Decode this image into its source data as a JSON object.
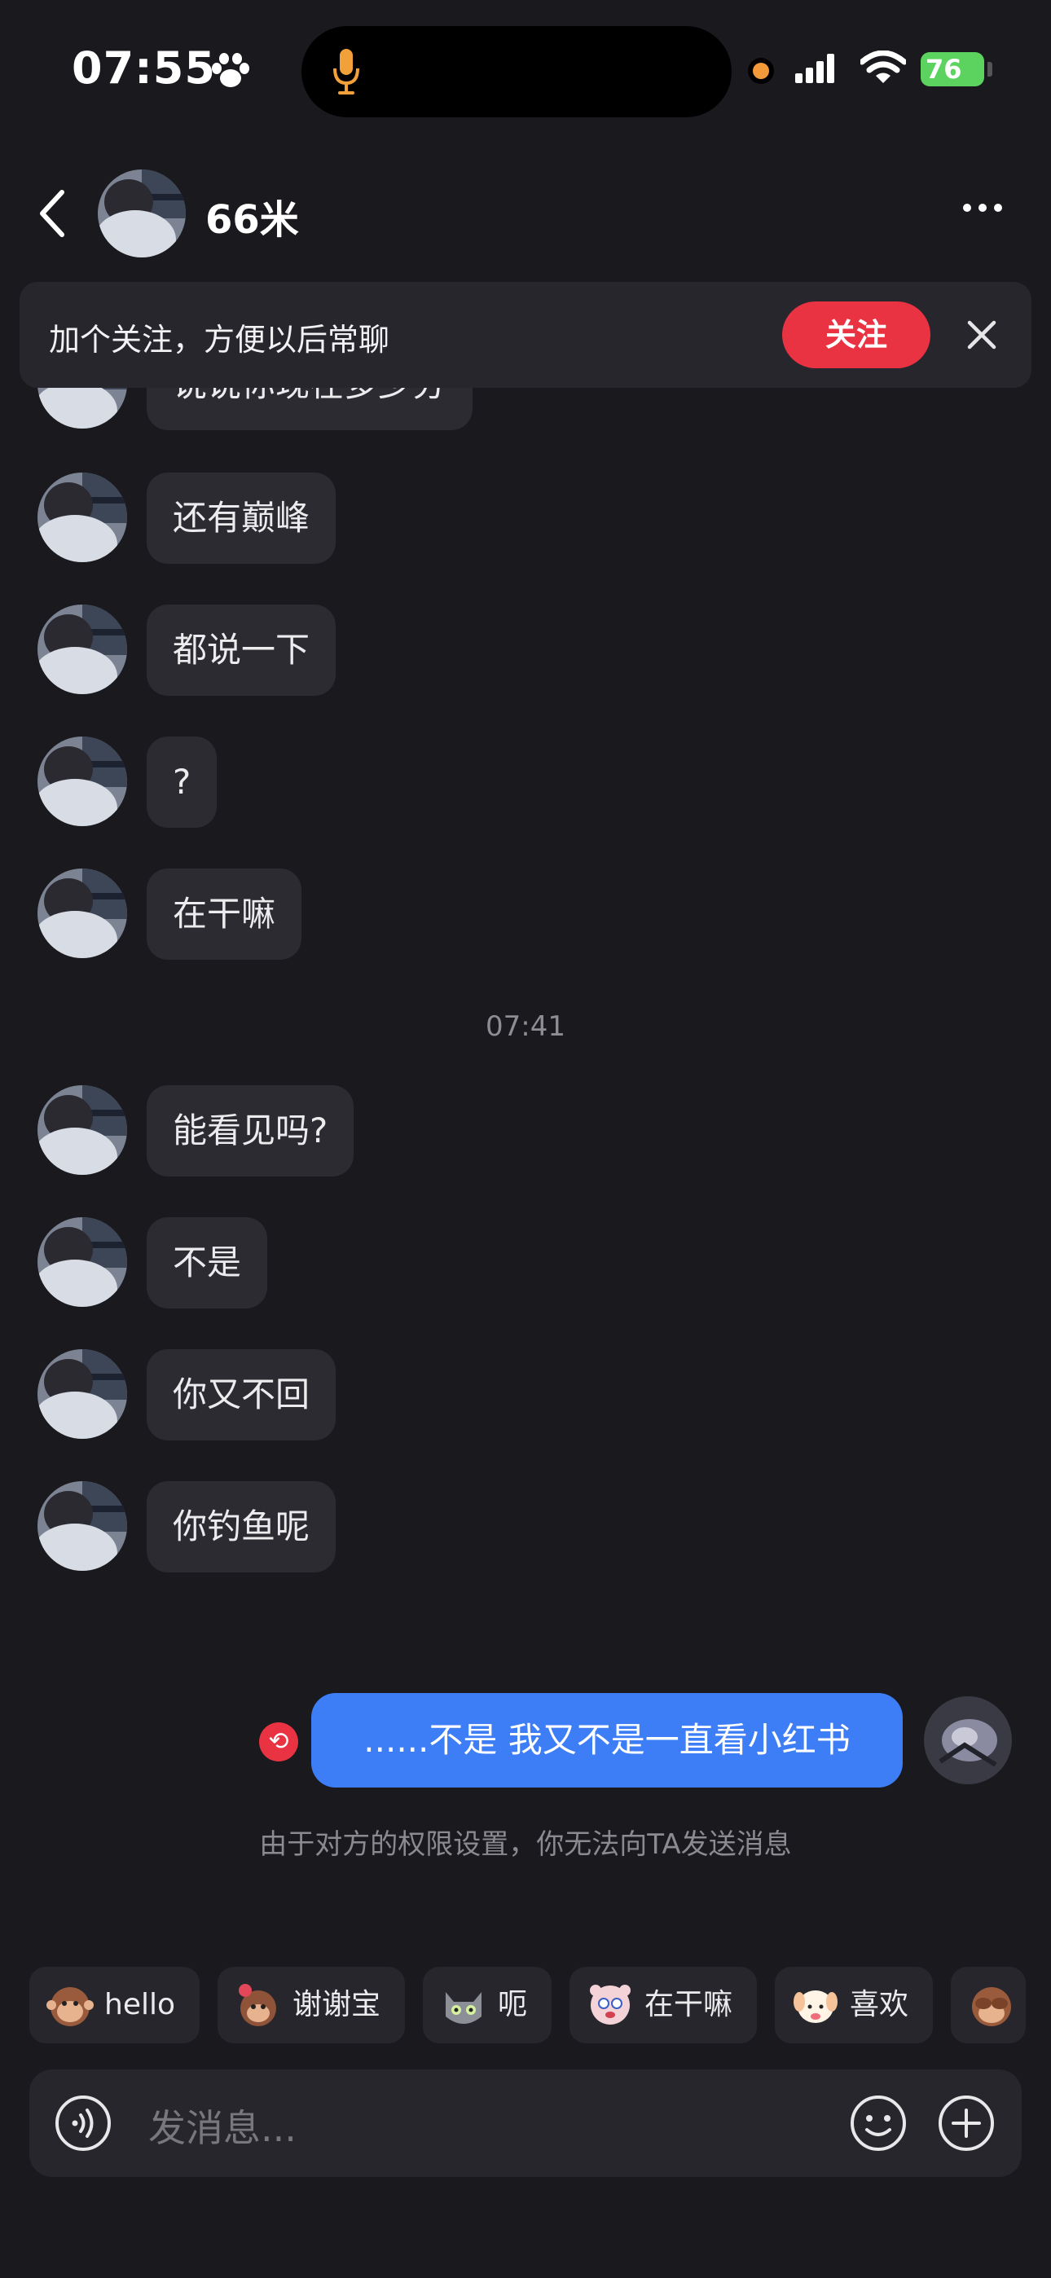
{
  "status_bar": {
    "time": "07:55",
    "battery": "76"
  },
  "header": {
    "title": "66米"
  },
  "banner": {
    "text": "加个关注，方便以后常聊",
    "follow_label": "关注"
  },
  "messages_before": [
    {
      "text": "说说你现在多少分"
    },
    {
      "text": "还有巅峰"
    },
    {
      "text": "都说一下"
    },
    {
      "text": "?"
    },
    {
      "text": "在干嘛"
    }
  ],
  "timestamp": "07:41",
  "messages_after": [
    {
      "text": "能看见吗?"
    },
    {
      "text": "不是"
    },
    {
      "text": "你又不回"
    },
    {
      "text": "你钓鱼呢"
    }
  ],
  "my_message": {
    "text": "......不是 我又不是一直看小红书"
  },
  "notice": "由于对方的权限设置，你无法向TA发送消息",
  "quick_replies": [
    {
      "label": "hello",
      "sticker": "monkey-sticker"
    },
    {
      "label": "谢谢宝",
      "sticker": "monkey-flower-sticker"
    },
    {
      "label": "呃",
      "sticker": "cat-sticker"
    },
    {
      "label": "在干嘛",
      "sticker": "bear-sticker"
    },
    {
      "label": "喜欢",
      "sticker": "dog-sticker"
    },
    {
      "label": "",
      "sticker": "monkey-cover-eyes-sticker"
    }
  ],
  "input": {
    "placeholder": "发消息..."
  },
  "colors": {
    "accent_red": "#ea3342",
    "my_bubble": "#3d7ef6",
    "background": "#19191e"
  }
}
